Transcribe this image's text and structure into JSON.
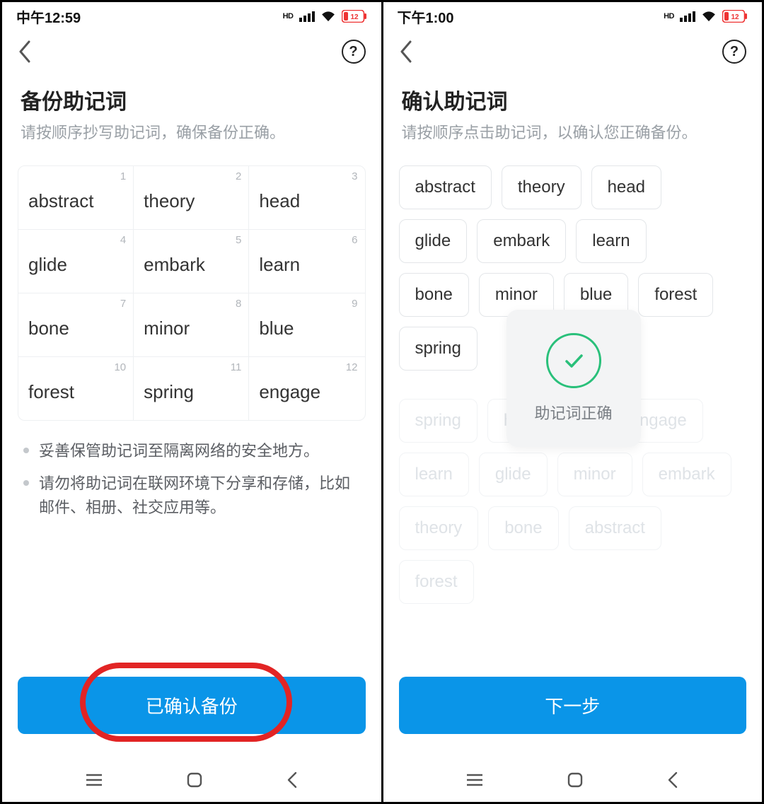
{
  "left": {
    "statusTime": "中午12:59",
    "battery": "12",
    "title": "备份助记词",
    "subtitle": "请按顺序抄写助记词，确保备份正确。",
    "words": [
      "abstract",
      "theory",
      "head",
      "glide",
      "embark",
      "learn",
      "bone",
      "minor",
      "blue",
      "forest",
      "spring",
      "engage"
    ],
    "nums": [
      "1",
      "2",
      "3",
      "4",
      "5",
      "6",
      "7",
      "8",
      "9",
      "10",
      "11",
      "12"
    ],
    "note1": "妥善保管助记词至隔离网络的安全地方。",
    "note2": "请勿将助记词在联网环境下分享和存储，比如邮件、相册、社交应用等。",
    "buttonLabel": "已确认备份"
  },
  "right": {
    "statusTime": "下午1:00",
    "battery": "12",
    "title": "确认助记词",
    "subtitle": "请按顺序点击助记词，以确认您正确备份。",
    "selected": [
      "abstract",
      "theory",
      "head",
      "glide",
      "embark",
      "learn",
      "bone",
      "minor",
      "blue",
      "forest",
      "spring"
    ],
    "pool": [
      "spring",
      "h",
      "blue",
      "engage",
      "learn",
      "glide",
      "minor",
      "embark",
      "theory",
      "bone",
      "abstract",
      "forest"
    ],
    "successText": "助记词正确",
    "buttonLabel": "下一步"
  },
  "colors": {
    "primary": "#0a95e8",
    "highlight": "#e22424",
    "success": "#29c07a"
  }
}
